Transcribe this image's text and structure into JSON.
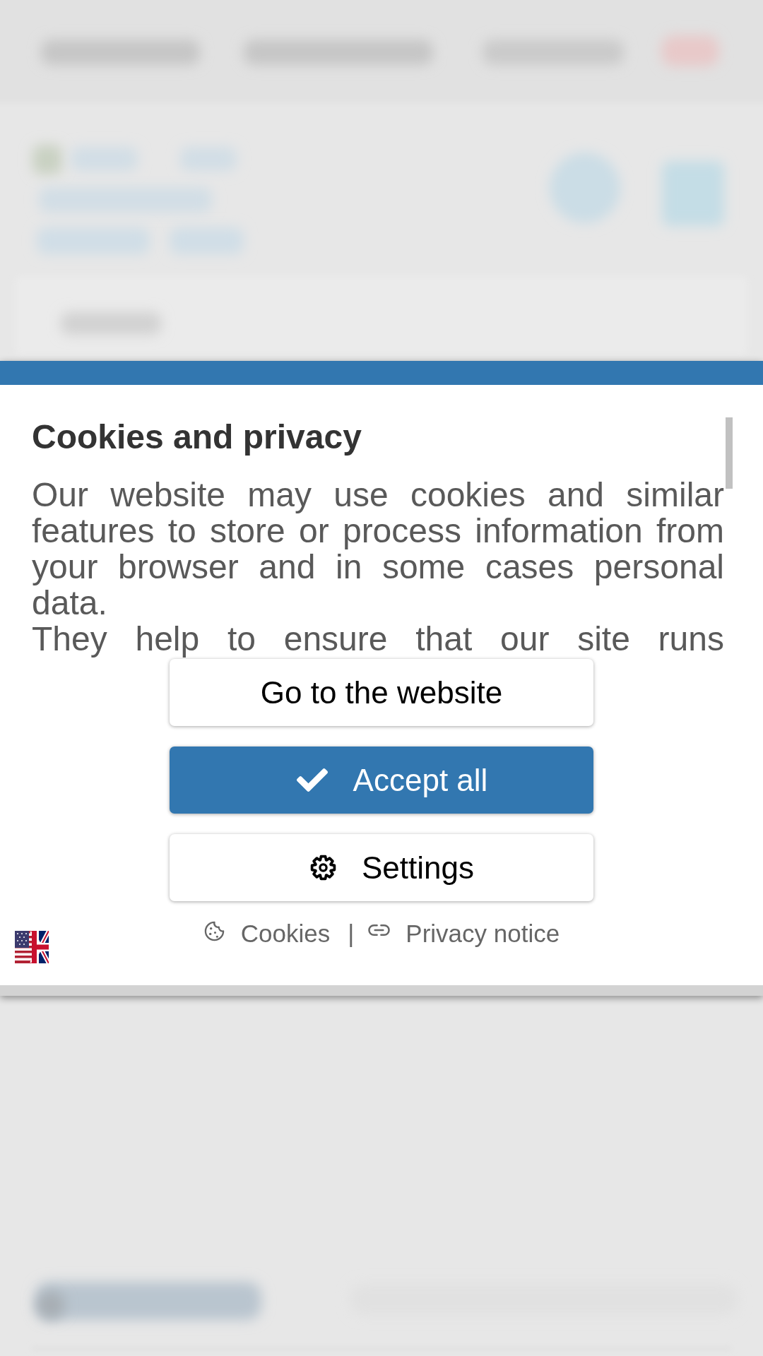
{
  "dialog": {
    "title": "Cookies and privacy",
    "paragraphs": [
      "Our website may use cookies and similar features to store or process information from your browser and in some cases personal data.",
      "They help to ensure that our site runs"
    ],
    "buttons": [
      {
        "label": "Go to the website",
        "kind": "plain"
      },
      {
        "label": "Accept all",
        "kind": "accept"
      },
      {
        "label": "Settings",
        "kind": "settings"
      }
    ],
    "links": [
      {
        "label": "Cookies",
        "kind": "cookie"
      },
      {
        "label": "Privacy notice",
        "kind": "link"
      }
    ],
    "separator": "|"
  }
}
